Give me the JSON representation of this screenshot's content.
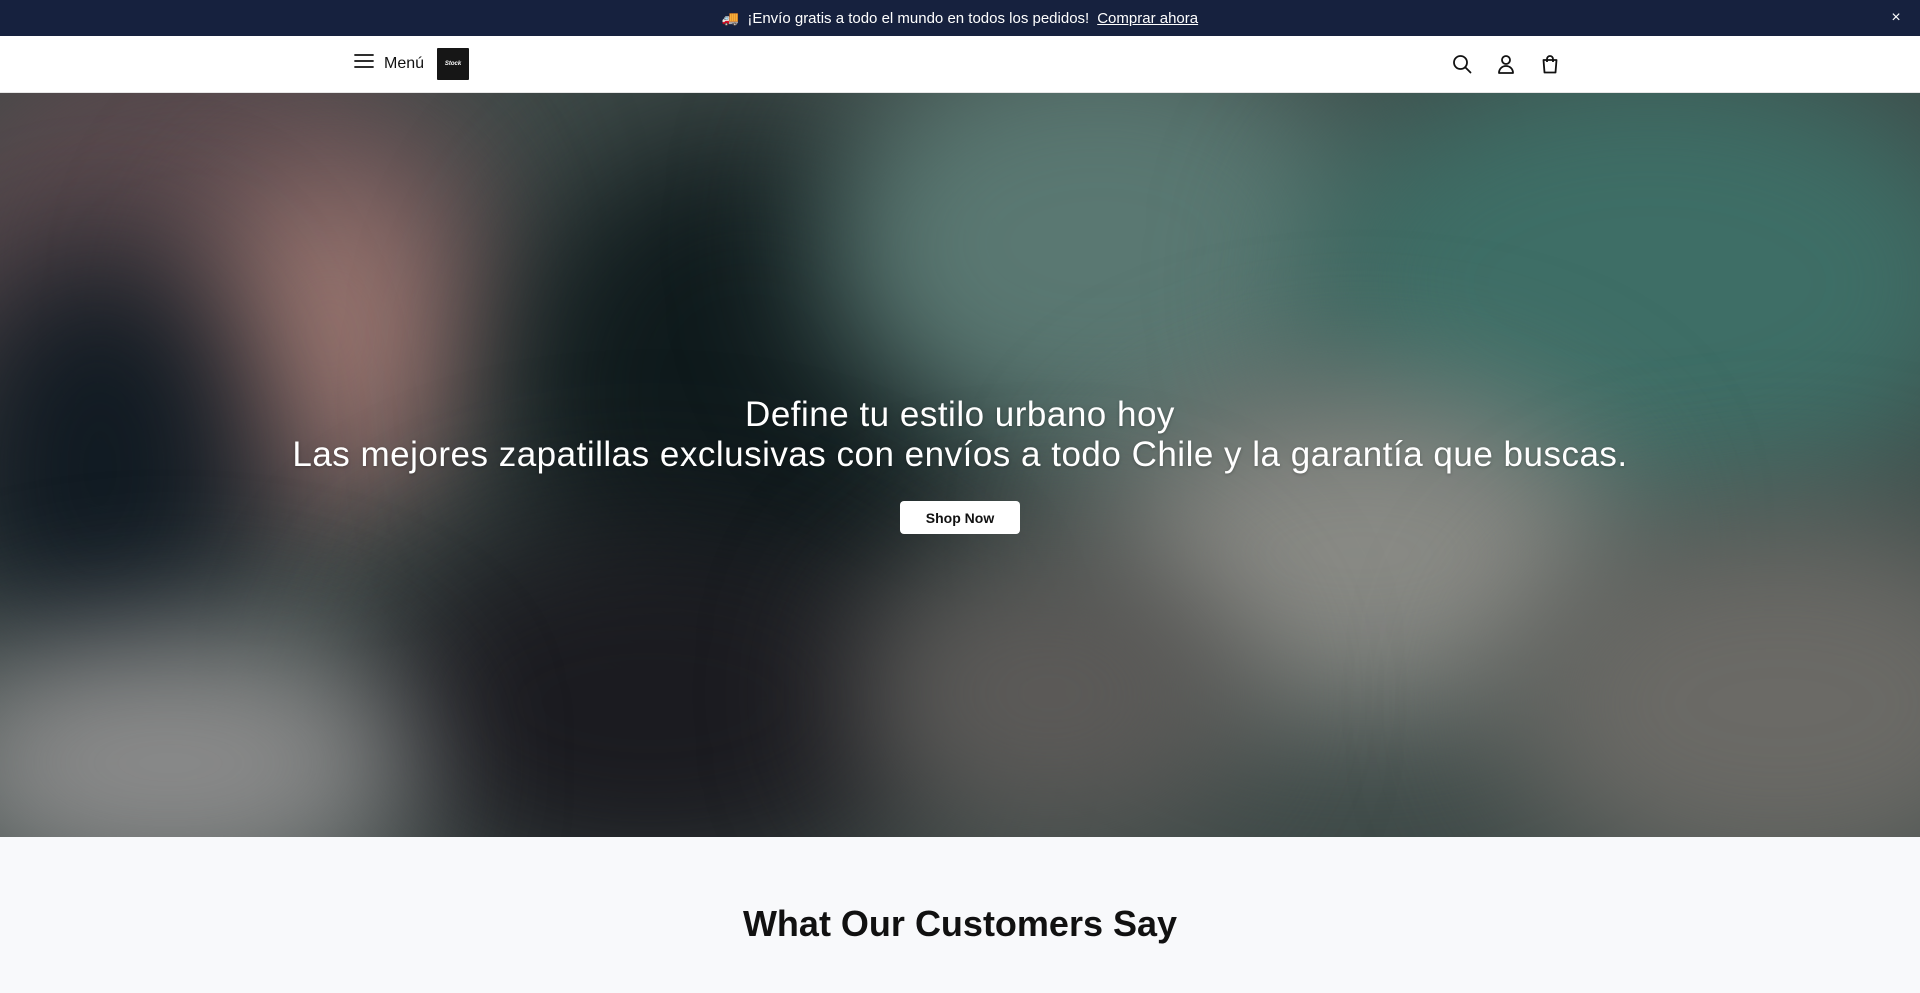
{
  "announcement": {
    "icon": "truck-icon",
    "text": "¡Envío gratis a todo el mundo en todos los pedidos!",
    "link_label": "Comprar ahora",
    "close_label": "×",
    "background": "#16213e"
  },
  "header": {
    "menu_label": "Menú",
    "logo_text": "Stock",
    "icons": [
      "search-icon",
      "account-icon",
      "cart-icon"
    ]
  },
  "hero": {
    "headline": "Define tu estilo urbano hoy",
    "subheadline": "Las mejores zapatillas exclusivas con envíos a todo Chile y la garantía que buscas.",
    "cta_label": "Shop Now"
  },
  "testimonials": {
    "title": "What Our Customers Say"
  }
}
